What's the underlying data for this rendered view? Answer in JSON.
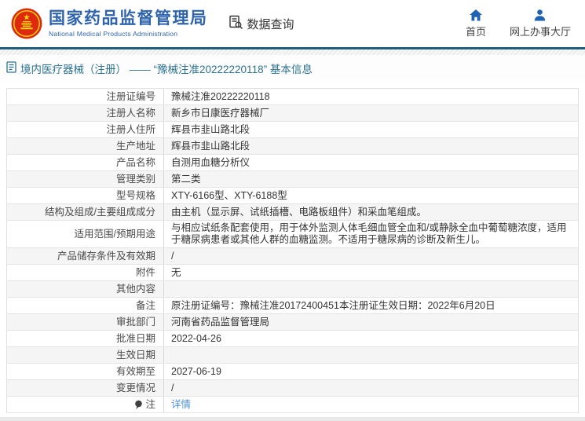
{
  "header": {
    "org_name_cn": "国家药品监督管理局",
    "org_name_en": "National Medical Products Administration",
    "data_query_label": "数据查询",
    "nav": [
      {
        "label": "首页",
        "icon": "home-icon"
      },
      {
        "label": "网上办事大厅",
        "icon": "person-icon"
      }
    ]
  },
  "breadcrumb": {
    "icon": "document-icon",
    "text": "境内医疗器械（注册） —— “豫械注准20222220118” 基本信息"
  },
  "table": {
    "rows": [
      {
        "label": "注册证编号",
        "value": "豫械注准20222220118"
      },
      {
        "label": "注册人名称",
        "value": "新乡市日康医疗器械厂"
      },
      {
        "label": "注册人住所",
        "value": "辉县市韭山路北段"
      },
      {
        "label": "生产地址",
        "value": "辉县市韭山路北段"
      },
      {
        "label": "产品名称",
        "value": "自测用血糖分析仪"
      },
      {
        "label": "管理类别",
        "value": "第二类"
      },
      {
        "label": "型号规格",
        "value": "XTY-6166型、XTY-6188型"
      },
      {
        "label": "结构及组成/主要组成成分",
        "value": "由主机（显示屏、试纸插槽、电路板组件）和采血笔组成。"
      },
      {
        "label": "适用范围/预期用途",
        "value": "与相应试纸条配套使用，用于体外监测人体毛细血管全血和/或静脉全血中葡萄糖浓度，适用于糖尿病患者或其他人群的血糖监测。不适用于糖尿病的诊断及新生儿。"
      },
      {
        "label": "产品储存条件及有效期",
        "value": "/"
      },
      {
        "label": "附件",
        "value": "无"
      },
      {
        "label": "其他内容",
        "value": ""
      },
      {
        "label": "备注",
        "value": "原注册证编号：豫械注准20172400451本注册证生效日期：2022年6月20日"
      },
      {
        "label": "审批部门",
        "value": "河南省药品监督管理局"
      },
      {
        "label": "批准日期",
        "value": "2022-04-26"
      },
      {
        "label": "生效日期",
        "value": ""
      },
      {
        "label": "有效期至",
        "value": "2027-06-19"
      },
      {
        "label": "变更情况",
        "value": "/"
      },
      {
        "label": "注",
        "value": "详情",
        "value_type": "link",
        "label_icon": "note-icon"
      }
    ]
  },
  "colors": {
    "brand_blue": "#2f64ad",
    "header_line_teal": "#215e7d",
    "breadcrumb_teal": "#2d7391",
    "link_blue": "#4a90d9",
    "emblem_red": "#de2910",
    "emblem_gold": "#ffde00",
    "alt_row_bg": "#f5f5f5",
    "icon_blue": "#1f62b4"
  }
}
